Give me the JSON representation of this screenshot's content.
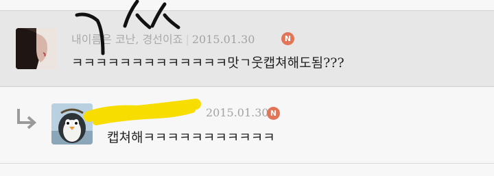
{
  "comments": [
    {
      "nickname": "내이름은 코난, 경선이죠",
      "date": "2015.01.30",
      "badge": "N",
      "text": "ㅋㅋㅋㅋㅋㅋㅋㅋㅋㅋㅋㅋㅋ맛ㄱ웃캡쳐해도됨???",
      "avatar": "profile-photo-woman"
    },
    {
      "nickname": "",
      "date": "2015.01.30",
      "badge": "N",
      "text": "캡쳐해ㅋㅋㅋㅋㅋㅋㅋㅋㅋㅋㅋ",
      "avatar": "penguin-avatar",
      "is_reply": true
    }
  ],
  "annotations": {
    "handwriting": "ㄱㅆ",
    "redaction_color": "#f7dd00"
  },
  "icons": {
    "reply": "reply-arrow-icon"
  }
}
